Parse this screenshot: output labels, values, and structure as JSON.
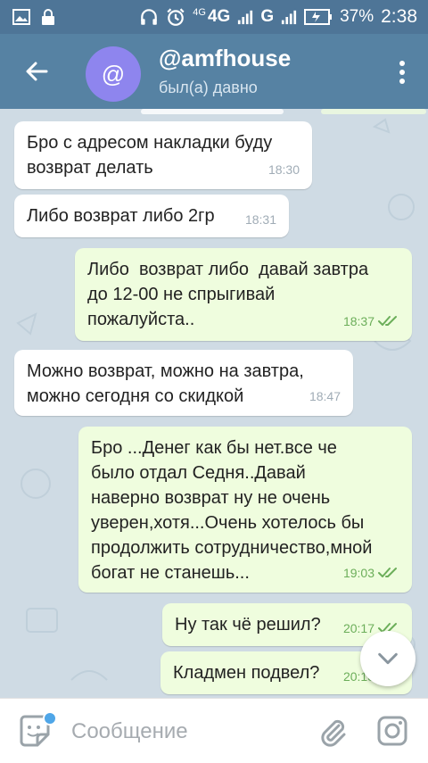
{
  "status_bar": {
    "network_label_1": "4G",
    "network_label_2": "4G",
    "network_label_3": "G",
    "battery": "37%",
    "time": "2:38"
  },
  "header": {
    "avatar_letter": "@",
    "title": "@amfhouse",
    "subtitle": "был(а) давно"
  },
  "messages": [
    {
      "direction": "in",
      "text": "Бро с адресом накладки буду\nвозврат делать",
      "time": "18:30"
    },
    {
      "direction": "in",
      "text": "Либо возврат либо 2гр",
      "time": "18:31"
    },
    {
      "direction": "out",
      "text": "Либо  возврат либо  давай завтра\nдо 12-00 не спрыгивай\nпожалуйста..",
      "time": "18:37"
    },
    {
      "direction": "in",
      "text": "Можно возврат, можно на завтра,\nможно сегодня со скидкой",
      "time": "18:47"
    },
    {
      "direction": "out",
      "text": "Бро ...Денег как бы нет.все че\nбыло отдал Седня..Давай\nнаверно возврат ну не очень\nуверен,хотя...Очень хотелось бы\nпродолжить сотрудничество,мной\nбогат не станешь...",
      "time": "19:03"
    },
    {
      "direction": "out",
      "text": "Ну так чё решил?",
      "time": "20:17"
    },
    {
      "direction": "out",
      "text": "Кладмен подвел?",
      "time": "20:18"
    }
  ],
  "input": {
    "placeholder": "Сообщение"
  },
  "colors": {
    "status_bar": "#4e7597",
    "app_bar": "#5682a3",
    "avatar": "#8e85ee",
    "chat_bg": "#cfdbe4",
    "bubble_in": "#ffffff",
    "bubble_out": "#effdde",
    "time_out": "#6cae5a"
  },
  "icons": [
    "gallery-icon",
    "lock-icon",
    "headphones-icon",
    "alarm-icon",
    "signal-icon",
    "battery-icon",
    "back-arrow-icon",
    "more-vert-icon",
    "sticker-icon",
    "attach-icon",
    "camera-icon",
    "chevron-down-icon",
    "double-check-icon"
  ]
}
